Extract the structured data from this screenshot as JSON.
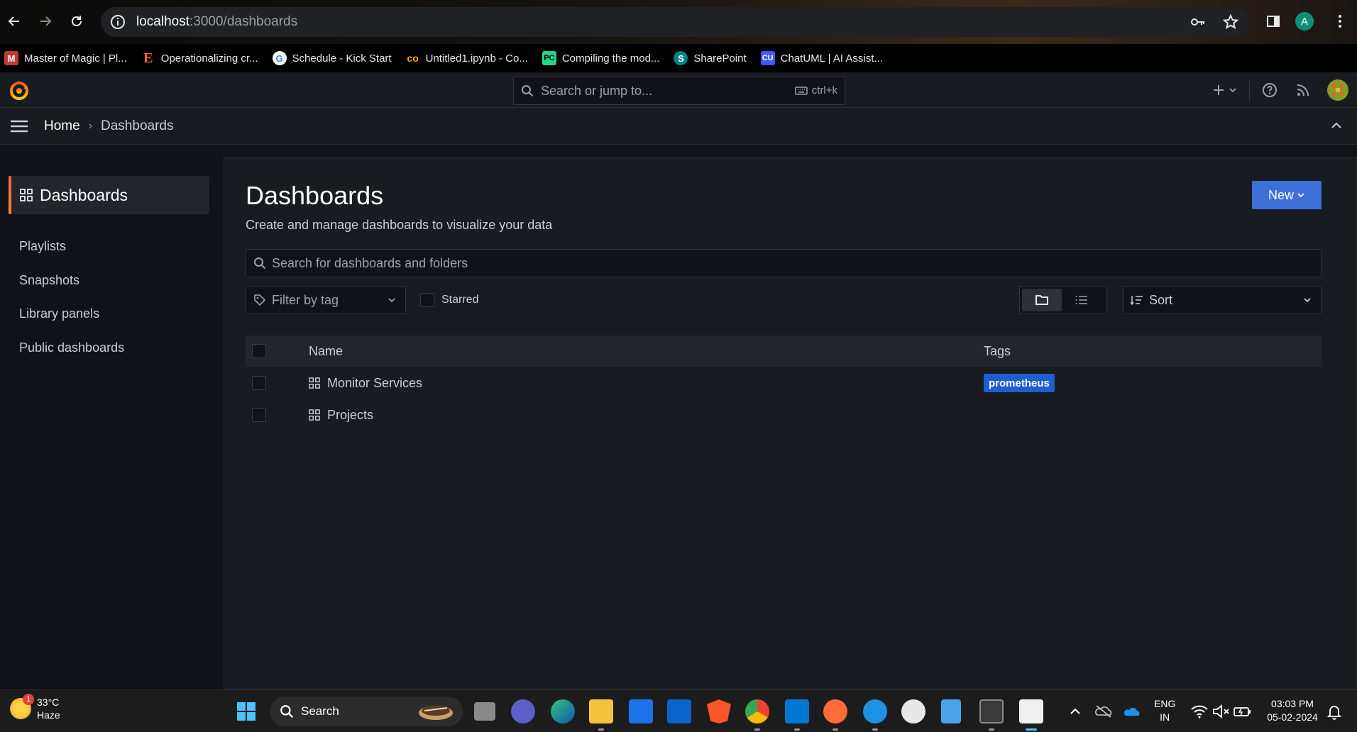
{
  "browser": {
    "url_host": "localhost",
    "url_path": ":3000/dashboards",
    "profile_initial": "A"
  },
  "bookmarks": [
    {
      "label": "Master of Magic | Pl...",
      "icon": "mom-icon",
      "color": "#c23b3b"
    },
    {
      "label": "Operationalizing cr...",
      "icon": "e-icon",
      "color": "#ff6b1a"
    },
    {
      "label": "Schedule - Kick Start",
      "icon": "google-icon",
      "color": "#4285f4"
    },
    {
      "label": "Untitled1.ipynb - Co...",
      "icon": "colab-icon",
      "color": "#f9ab00"
    },
    {
      "label": "Compiling the mod...",
      "icon": "pycharm-icon",
      "color": "#21d789"
    },
    {
      "label": "SharePoint",
      "icon": "sharepoint-icon",
      "color": "#038387"
    },
    {
      "label": "ChatUML | AI Assist...",
      "icon": "chatuml-icon",
      "color": "#3d5afe"
    }
  ],
  "topbar": {
    "search_placeholder": "Search or jump to...",
    "shortcut": "ctrl+k"
  },
  "breadcrumb": {
    "home": "Home",
    "current": "Dashboards"
  },
  "sidebar": {
    "active": "Dashboards",
    "items": [
      "Playlists",
      "Snapshots",
      "Library panels",
      "Public dashboards"
    ]
  },
  "main": {
    "title": "Dashboards",
    "subtitle": "Create and manage dashboards to visualize your data",
    "new_label": "New",
    "search_placeholder": "Search for dashboards and folders",
    "filter_tag_placeholder": "Filter by tag",
    "starred_label": "Starred",
    "sort_label": "Sort",
    "columns": {
      "name": "Name",
      "tags": "Tags"
    },
    "rows": [
      {
        "name": "Monitor Services",
        "tag": "prometheus"
      },
      {
        "name": "Projects",
        "tag": ""
      }
    ],
    "tag_color": "#1f5ed1",
    "accent": "#3d71d9"
  },
  "taskbar": {
    "weather_temp": "33°C",
    "weather_desc": "Haze",
    "weather_badge": "1",
    "search_label": "Search",
    "lang_1": "ENG",
    "lang_2": "IN",
    "time": "03:03 PM",
    "date": "05-02-2024"
  }
}
